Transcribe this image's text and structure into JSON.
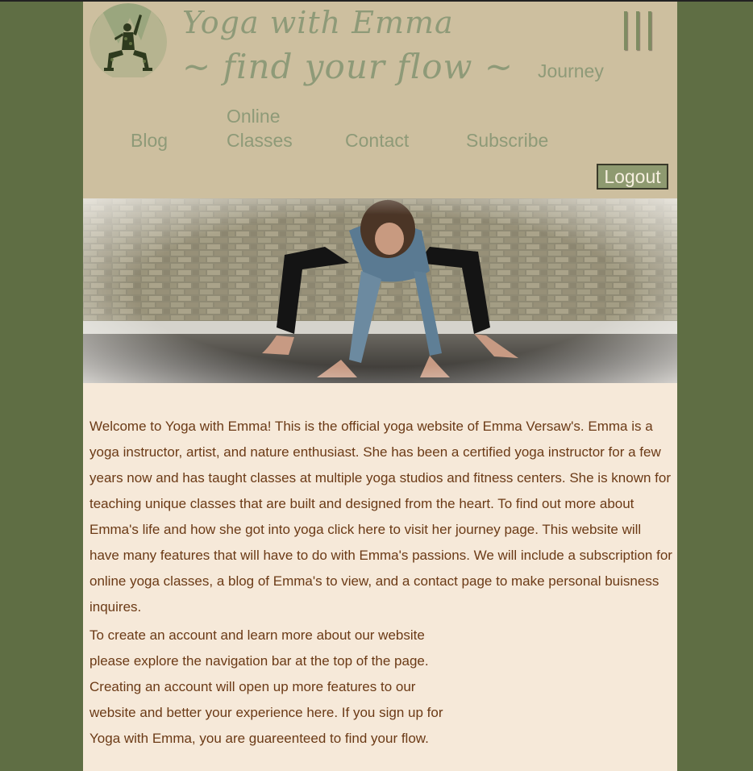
{
  "brand": {
    "title": "Yoga with Emma",
    "tagline": "~ find your flow ~"
  },
  "nav": {
    "journey": "Journey",
    "blog": "Blog",
    "online_classes": "Online Classes",
    "contact": "Contact",
    "subscribe": "Subscribe",
    "logout": "Logout"
  },
  "icons": {
    "logo": "yoga-pose-logo-icon",
    "menu": "menu-icon"
  },
  "content": {
    "intro": "Welcome to Yoga with Emma! This is the official yoga website of Emma Versaw's. Emma is a yoga instructor, artist, and nature enthusiast. She has been a certified yoga instructor for a few years now and has taught classes at multiple yoga studios and fitness centers. She is known for teaching unique classes that are built and designed from the heart. To find out more about Emma's life and how she got into yoga click here to visit her journey page. This website will have many features that will have to do with Emma's passions. We will include a subscription for online yoga classes, a blog of Emma's to view, and a contact page to make personal buisness inquires.",
    "account": "To create an account and learn more about our website please explore the navigation bar at the top of the page. Creating an account will open up more features to our website and better your experience here. If you sign up for Yoga with Emma, you are guareenteed to find your flow."
  },
  "colors": {
    "outer_background": "#5f6e44",
    "header_background": "#cdbf9f",
    "page_background": "#f6e9d9",
    "brand_text": "#8e9a78",
    "body_text": "#6b3a16",
    "logout_button": "#8e9a70"
  }
}
